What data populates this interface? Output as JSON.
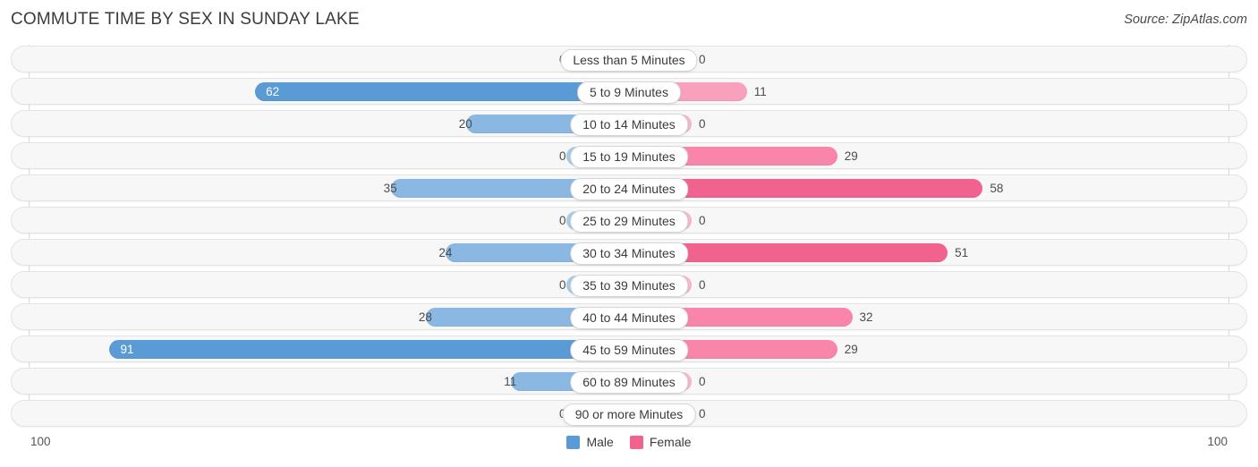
{
  "header": {
    "title": "COMMUTE TIME BY SEX IN SUNDAY LAKE",
    "source": "Source: ZipAtlas.com"
  },
  "axis": {
    "left_label": "100",
    "right_label": "100"
  },
  "legend": {
    "items": [
      {
        "label": "Male",
        "color": "#5b9bd5"
      },
      {
        "label": "Female",
        "color": "#f2628f"
      }
    ]
  },
  "colors": {
    "male_light": "#a8cbea",
    "male_mid": "#8ab8e3",
    "male_strong": "#5b9bd5",
    "female_light": "#f9b4c9",
    "female_mid": "#f985ab",
    "female_strong": "#f2628f",
    "row_track": "#f7f7f7",
    "row_border": "#e3e3e3",
    "gridline": "#d8d8d8"
  },
  "chart_data": {
    "type": "bar",
    "title": "COMMUTE TIME BY SEX IN SUNDAY LAKE",
    "subtitle": "",
    "orientation": "horizontal-diverging",
    "xlabel": "",
    "ylabel": "",
    "xlim": [
      100,
      100
    ],
    "grid": true,
    "legend_position": "bottom-center",
    "categories": [
      "Less than 5 Minutes",
      "5 to 9 Minutes",
      "10 to 14 Minutes",
      "15 to 19 Minutes",
      "20 to 24 Minutes",
      "25 to 29 Minutes",
      "30 to 34 Minutes",
      "35 to 39 Minutes",
      "40 to 44 Minutes",
      "45 to 59 Minutes",
      "60 to 89 Minutes",
      "90 or more Minutes"
    ],
    "series": [
      {
        "name": "Male",
        "values": [
          0,
          62,
          20,
          0,
          35,
          0,
          24,
          0,
          28,
          91,
          11,
          0
        ]
      },
      {
        "name": "Female",
        "values": [
          0,
          11,
          0,
          29,
          58,
          0,
          51,
          0,
          32,
          29,
          0,
          0
        ]
      }
    ]
  }
}
